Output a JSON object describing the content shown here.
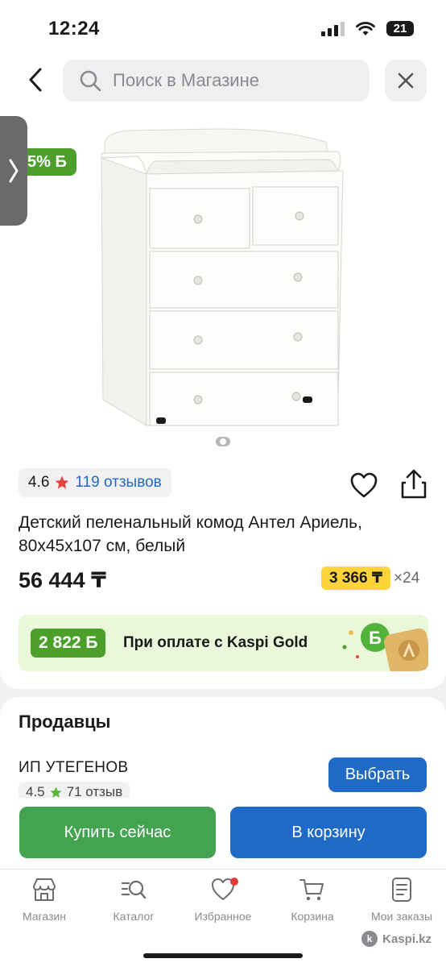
{
  "status_bar": {
    "time": "12:24",
    "battery": "21"
  },
  "search": {
    "placeholder": "Поиск в Магазине"
  },
  "gallery": {
    "bonus_badge": "5% Б"
  },
  "product": {
    "rating": "4.6",
    "reviews": "119 отзывов",
    "title": "Детский пеленальный комод Антел Ариель, 80х45х107 см, белый",
    "price": "56 444 ₸",
    "installment_amount": "3 366 ₸",
    "installment_months": "×24"
  },
  "kaspi_gold": {
    "bonus": "2 822 Б",
    "text": "При оплате с Kaspi Gold"
  },
  "sellers": {
    "title": "Продавцы",
    "seller_name": "ИП УТЕГЕНОВ",
    "seller_rating": "4.5",
    "seller_reviews": "71 отзыв",
    "choose_label": "Выбрать"
  },
  "actions": {
    "buy_now": "Купить сейчас",
    "add_to_cart": "В корзину"
  },
  "tabs": [
    {
      "label": "Магазин",
      "icon": "store-icon"
    },
    {
      "label": "Каталог",
      "icon": "catalog-search-icon"
    },
    {
      "label": "Избранное",
      "icon": "heart-icon"
    },
    {
      "label": "Корзина",
      "icon": "cart-icon"
    },
    {
      "label": "Мои заказы",
      "icon": "orders-icon"
    }
  ],
  "watermark": "Kaspi.kz",
  "colors": {
    "accent_blue": "#1e6ac6",
    "bonus_green": "#4d9f2c",
    "buy_green": "#43a350",
    "installment_yellow": "#ffd43a",
    "star_red": "#e8453c",
    "star_green": "#5cb83a"
  }
}
